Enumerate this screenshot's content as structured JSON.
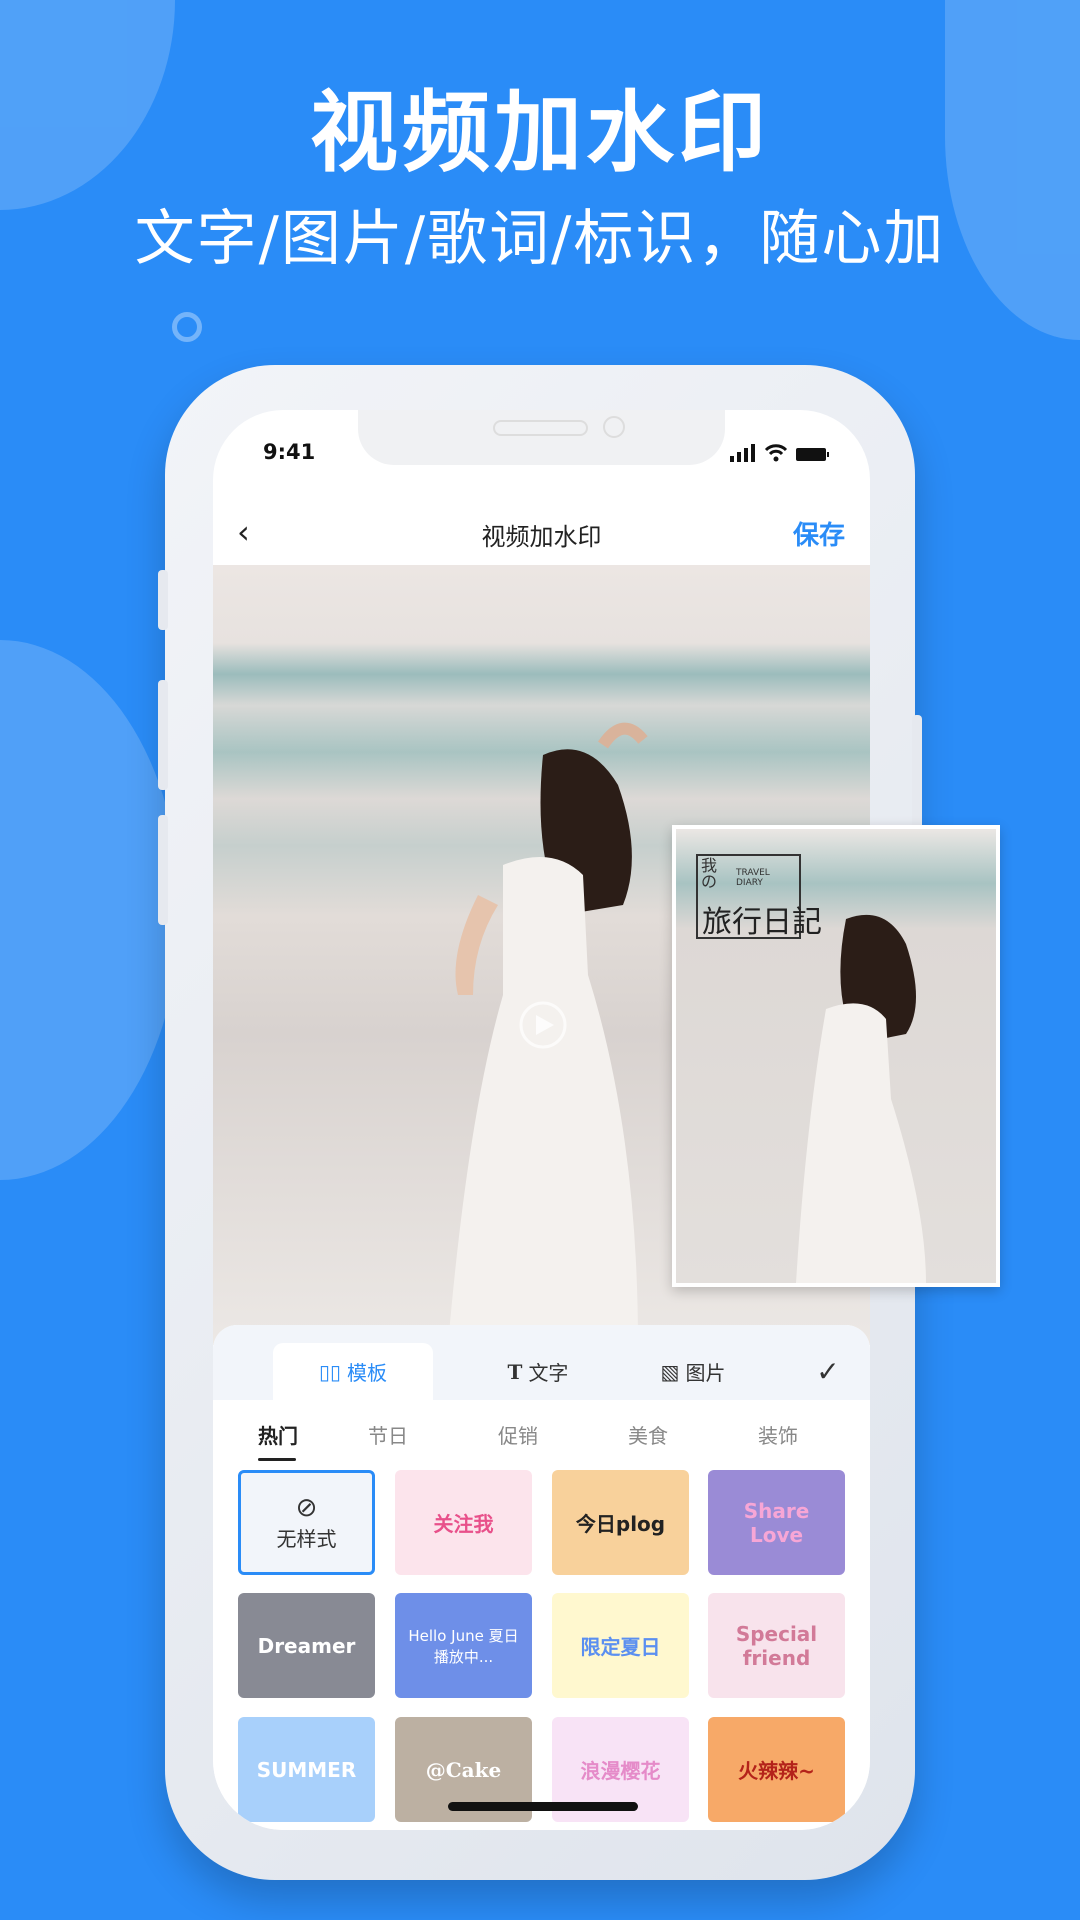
{
  "promo": {
    "headline": "视频加水印",
    "subtitle": "文字/图片/歌词/标识，随心加"
  },
  "status_bar": {
    "time": "9:41"
  },
  "nav": {
    "title": "视频加水印",
    "save": "保存"
  },
  "tabs": [
    {
      "label": "模板",
      "icon": "template-icon",
      "active": true
    },
    {
      "label": "文字",
      "icon": "text-icon"
    },
    {
      "label": "图片",
      "icon": "image-icon"
    }
  ],
  "categories": [
    {
      "label": "热门",
      "active": true
    },
    {
      "label": "节日"
    },
    {
      "label": "促销"
    },
    {
      "label": "美食"
    },
    {
      "label": "装饰"
    }
  ],
  "templates": [
    {
      "label": "无样式",
      "bg": "#f2f5fa",
      "color": "#333",
      "selected": true
    },
    {
      "label": "关注我",
      "bg": "#fce4ec",
      "color": "#e8508a"
    },
    {
      "label": "今日plog",
      "bg": "#f8d19b",
      "color": "#222"
    },
    {
      "label": "Share Love",
      "bg": "#9a8bd6",
      "color": "#f7a6d6"
    },
    {
      "label": "Dreamer",
      "bg": "#888a94",
      "color": "#fff"
    },
    {
      "label": "Hello June 夏日播放中...",
      "bg": "#6e8fe8",
      "color": "#fff"
    },
    {
      "label": "限定夏日",
      "bg": "#fff8cf",
      "color": "#5b8ff0"
    },
    {
      "label": "Special friend",
      "bg": "#f8e3ec",
      "color": "#d27a98"
    },
    {
      "label": "SUMMER",
      "bg": "#a8d0fb",
      "color": "#fff"
    },
    {
      "label": "@Cake",
      "bg": "#bcb0a2",
      "color": "#fff"
    },
    {
      "label": "浪漫樱花",
      "bg": "#f8e3f6",
      "color": "#e58bc9"
    },
    {
      "label": "火辣辣~",
      "bg": "#f7a968",
      "color": "#b4231a"
    }
  ],
  "overlay_card": {
    "line1": "我の",
    "line2": "TRAVEL DIARY",
    "line3": "旅行日記"
  },
  "colors": {
    "background": "#2a8cf7",
    "accent": "#2a8cf7"
  }
}
